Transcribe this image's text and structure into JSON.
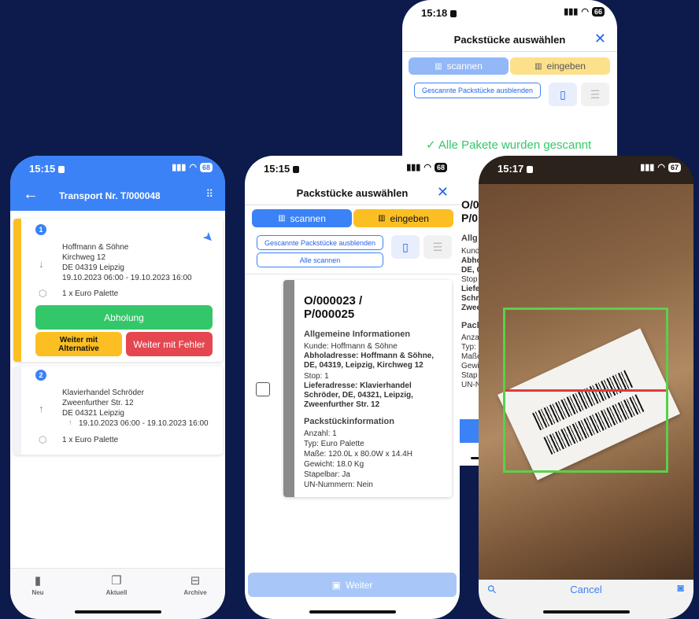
{
  "colors": {
    "bg": "#0c1a4c",
    "blue": "#3b82f6",
    "yellow": "#fbbf24",
    "green": "#34c76a",
    "red": "#e5464f"
  },
  "phone1": {
    "time": "15:15",
    "battery": "68",
    "title": "Transport Nr. T/000048",
    "stops": [
      {
        "num": "1",
        "name": "Hoffmann & Söhne",
        "street": "Kirchweg 12",
        "city": "DE 04319 Leipzig",
        "window": "19.10.2023 06:00 - 19.10.2023 16:00",
        "cargo": "1 x Euro Palette"
      },
      {
        "num": "2",
        "name": "Klavierhandel Schröder",
        "street": "Zweenfurther Str. 12",
        "city": "DE 04321 Leipzig",
        "window": "19.10.2023 06:00 - 19.10.2023 16:00",
        "cargo": "1 x Euro Palette"
      }
    ],
    "btn_pickup": "Abholung",
    "btn_alt": "Weiter mit Alternative",
    "btn_err": "Weiter mit Fehler",
    "nav": [
      "Neu",
      "Aktuell",
      "Archive"
    ]
  },
  "phone2": {
    "time": "15:15",
    "battery": "68",
    "title": "Packstücke auswählen",
    "tab_scan": "scannen",
    "tab_enter": "eingeben",
    "hide_btn": "Gescannte Packstücke ausblenden",
    "scan_all": "Alle scannen",
    "card": {
      "id": "O/000023 / P/000025",
      "general_h": "Allgemeine Informationen",
      "customer": "Kunde: Hoffmann & Söhne",
      "pickup": "Abholadresse: Hoffmann & Söhne, DE, 04319, Leipzig, Kirchweg 12",
      "stop": "Stop: 1",
      "delivery": "Lieferadresse: Klavierhandel Schröder, DE, 04321, Leipzig, Zweenfurther Str. 12",
      "pkg_h": "Packstückinformation",
      "count": "Anzahl: 1",
      "type": "Typ: Euro Palette",
      "dims": "Maße: 120.0L x 80.0W x 14.4H",
      "weight": "Gewicht: 18.0 Kg",
      "stackable": "Stapelbar: Ja",
      "un": "UN-Nummern: Nein"
    },
    "next": "Weiter"
  },
  "phone3": {
    "time": "15:18",
    "battery": "66",
    "title": "Packstücke auswählen",
    "tab_scan": "scannen",
    "tab_enter": "eingeben",
    "hide_btn": "Gescannte Packstücke ausblenden",
    "done": "Alle Pakete wurden gescannt",
    "peek": [
      "O/0",
      "P/0",
      "Allg",
      "Kund",
      "Abho",
      "DE, C",
      "Stop",
      "Liefe",
      "Schr",
      "Zwee",
      "Pack",
      "Anza",
      "Typ:",
      "Maße",
      "Gewi",
      "Stap",
      "UN-N"
    ]
  },
  "phone4": {
    "time": "15:17",
    "battery": "67",
    "cancel": "Cancel"
  }
}
